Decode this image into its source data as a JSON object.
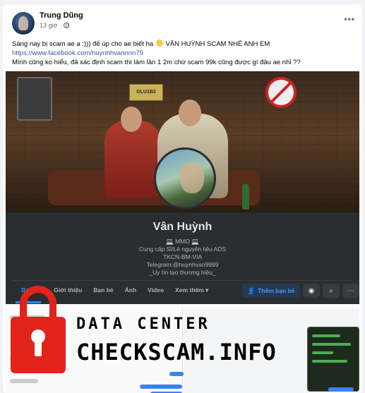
{
  "post": {
    "author": "Trung Dũng",
    "time": "13 giờ",
    "privacy_icon": "globe-icon",
    "more_icon": "more-horizontal-icon",
    "line1_a": "Sáng nay bị scam ae ạ :))) để úp cho ae biết ha",
    "line1_b": "VĂN HUỲNH SCAM NHÉ ANH EM",
    "link": "https://www.facebook.com/huynhhvannnn79",
    "line3": "Mình cũng ko hiểu, đã xác định scam thì làm lần 1 2m chứ scam 99k cũng được gì đâu ae nhỉ ??"
  },
  "profile": {
    "cover_plate": "GLU1B2",
    "name": "Vân Huỳnh",
    "bio": [
      "💻 MMO 💻",
      "Cung cấp Sỉ/Lẻ nguyên liệu ADS",
      "TKCN-BM-VIA",
      "Telegram:@huynhvan9999",
      "_Uy tín tạo thương hiệu_"
    ],
    "tabs": [
      "Bài viết",
      "Giới thiệu",
      "Bạn bè",
      "Ảnh",
      "Video",
      "Xem thêm ▾"
    ],
    "add_friend": "Thêm bạn bè",
    "messenger_icon": "messenger-icon",
    "search_icon": "search-icon",
    "more_icon": "more-horizontal-icon"
  },
  "watermark": {
    "line1": "DATA CENTER",
    "line2": "CHECKSCAM.INFO",
    "icon": "padlock-icon",
    "color": "#e2231a"
  },
  "colors": {
    "link": "#385898",
    "accent": "#2d88ff",
    "dark_bg": "#2b2d31"
  }
}
